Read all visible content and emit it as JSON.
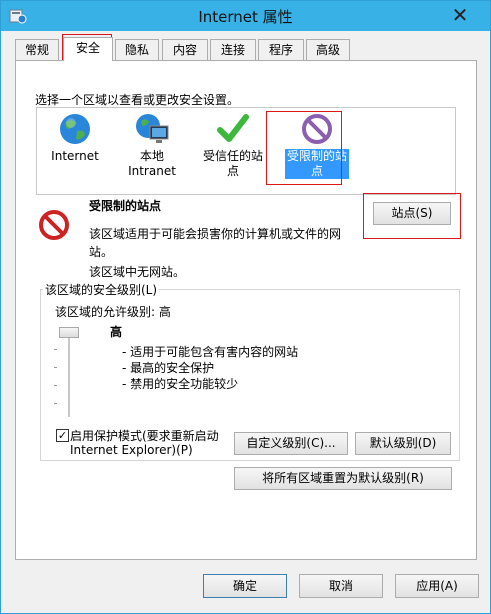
{
  "window": {
    "title": "Internet 属性",
    "close": "✕"
  },
  "tabs": [
    "常规",
    "安全",
    "隐私",
    "内容",
    "连接",
    "程序",
    "高级"
  ],
  "instruction": "选择一个区域以查看或更改安全设置。",
  "zones": [
    {
      "label": "Internet",
      "icon": "globe-icon"
    },
    {
      "label": "本地\nIntranet",
      "icon": "computer-globe-icon"
    },
    {
      "label": "受信任的站\n点",
      "icon": "checkmark-icon"
    },
    {
      "label": "受限制的站\n点",
      "icon": "restricted-icon",
      "selected": true
    }
  ],
  "zone_info": {
    "title": "受限制的站点",
    "description_line1": "该区域适用于可能会损害你的计算机或文件的网",
    "description_line2": "站。",
    "no_sites": "该区域中无网站。",
    "sites_button": "站点(S)"
  },
  "security_level": {
    "group_title": "该区域的安全级别(L)",
    "allowed_level": "该区域的允许级别: 高",
    "level_name": "高",
    "bullets": [
      "- 适用于可能包含有害内容的网站",
      "- 最高的安全保护",
      "- 禁用的安全功能较少"
    ],
    "protected_mode_line1": "启用保护模式(要求重新启动",
    "protected_mode_line2": "Internet Explorer)(P)",
    "protected_mode_checked": true,
    "custom_level_button": "自定义级别(C)...",
    "default_level_button": "默认级别(D)",
    "reset_all_button": "将所有区域重置为默认级别(R)"
  },
  "footer": {
    "ok": "确定",
    "cancel": "取消",
    "apply": "应用(A)"
  },
  "colors": {
    "accent": "#3399ff",
    "titlebar": "#38b2e6",
    "highlight_box": "#d9181a"
  }
}
